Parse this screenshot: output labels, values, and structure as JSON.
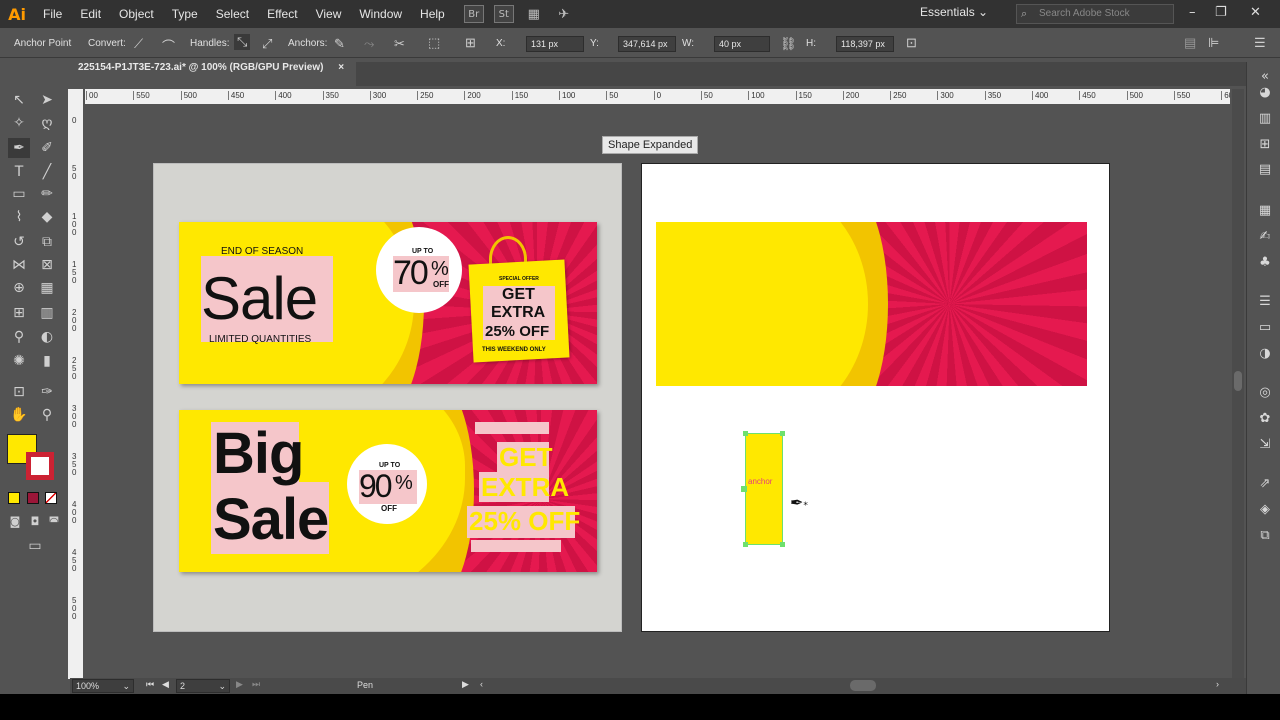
{
  "app": {
    "logo": "Ai"
  },
  "menu": [
    "File",
    "Edit",
    "Object",
    "Type",
    "Select",
    "Effect",
    "View",
    "Window",
    "Help"
  ],
  "bridge": {
    "br": "Br",
    "st": "St"
  },
  "workspace": "Essentials",
  "search_placeholder": "Search Adobe Stock",
  "control": {
    "tool_label": "Anchor Point",
    "convert": "Convert:",
    "handles": "Handles:",
    "anchors": "Anchors:",
    "x_label": "X:",
    "x_value": "131 px",
    "y_label": "Y:",
    "y_value": "347,614 px",
    "w_label": "W:",
    "w_value": "40 px",
    "h_label": "H:",
    "h_value": "118,397 px"
  },
  "tab": {
    "title": "225154-P1JT3E-723.ai* @ 100% (RGB/GPU Preview)",
    "close": "×"
  },
  "ruler_h": [
    "00",
    "550",
    "500",
    "450",
    "400",
    "350",
    "300",
    "250",
    "200",
    "150",
    "100",
    "50",
    "0",
    "50",
    "100",
    "150",
    "200",
    "250",
    "300",
    "350",
    "400",
    "450",
    "500",
    "550",
    "600"
  ],
  "ruler_v": [
    "0",
    "5\n0",
    "1\n0\n0",
    "1\n5\n0",
    "2\n0\n0",
    "2\n5\n0",
    "3\n0\n0",
    "3\n5\n0",
    "4\n0\n0",
    "4\n5\n0",
    "5\n0\n0"
  ],
  "tooltip": "Shape Expanded",
  "banner1": {
    "headline1": "END OF SEASON",
    "headline2": "Sale",
    "headline3": "LIMITED QUANTITIES",
    "badge_top": "UP TO",
    "badge_value": "70",
    "badge_pct": "%",
    "badge_off": "OFF",
    "bag_top": "SPECIAL OFFER",
    "bag_line1": "GET",
    "bag_line2": "EXTRA",
    "bag_line3": "25% OFF",
    "bag_bottom": "THIS WEEKEND ONLY"
  },
  "banner2": {
    "line1": "Big",
    "line2": "Sale",
    "badge_top": "UP TO",
    "badge_value": "90",
    "badge_pct": "%",
    "badge_off": "OFF",
    "line_a": "GET",
    "line_b": "EXTRA",
    "line_c": "25% OFF"
  },
  "selection": {
    "label": "anchor"
  },
  "status": {
    "zoom": "100%",
    "page": "2",
    "tool": "Pen"
  },
  "colors": {
    "yellow": "#ffe800",
    "red": "#e5194f",
    "pink": "#f5c6ca",
    "accent": "#6ee06e"
  }
}
